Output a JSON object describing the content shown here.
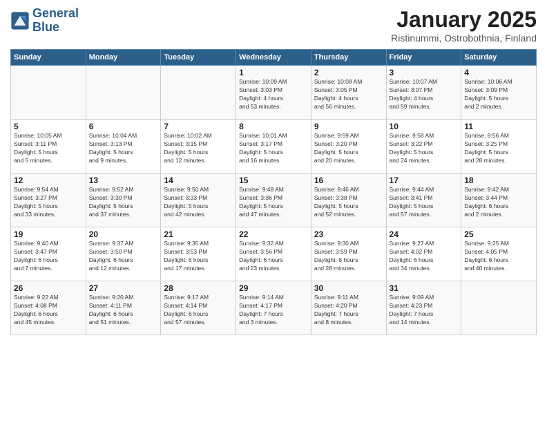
{
  "header": {
    "logo_line1": "General",
    "logo_line2": "Blue",
    "month_year": "January 2025",
    "location": "Ristinummi, Ostrobothnia, Finland"
  },
  "weekdays": [
    "Sunday",
    "Monday",
    "Tuesday",
    "Wednesday",
    "Thursday",
    "Friday",
    "Saturday"
  ],
  "weeks": [
    [
      {
        "day": "",
        "info": ""
      },
      {
        "day": "",
        "info": ""
      },
      {
        "day": "",
        "info": ""
      },
      {
        "day": "1",
        "info": "Sunrise: 10:09 AM\nSunset: 3:03 PM\nDaylight: 4 hours\nand 53 minutes."
      },
      {
        "day": "2",
        "info": "Sunrise: 10:08 AM\nSunset: 3:05 PM\nDaylight: 4 hours\nand 56 minutes."
      },
      {
        "day": "3",
        "info": "Sunrise: 10:07 AM\nSunset: 3:07 PM\nDaylight: 4 hours\nand 59 minutes."
      },
      {
        "day": "4",
        "info": "Sunrise: 10:06 AM\nSunset: 3:09 PM\nDaylight: 5 hours\nand 2 minutes."
      }
    ],
    [
      {
        "day": "5",
        "info": "Sunrise: 10:05 AM\nSunset: 3:11 PM\nDaylight: 5 hours\nand 5 minutes."
      },
      {
        "day": "6",
        "info": "Sunrise: 10:04 AM\nSunset: 3:13 PM\nDaylight: 5 hours\nand 9 minutes."
      },
      {
        "day": "7",
        "info": "Sunrise: 10:02 AM\nSunset: 3:15 PM\nDaylight: 5 hours\nand 12 minutes."
      },
      {
        "day": "8",
        "info": "Sunrise: 10:01 AM\nSunset: 3:17 PM\nDaylight: 5 hours\nand 16 minutes."
      },
      {
        "day": "9",
        "info": "Sunrise: 9:59 AM\nSunset: 3:20 PM\nDaylight: 5 hours\nand 20 minutes."
      },
      {
        "day": "10",
        "info": "Sunrise: 9:58 AM\nSunset: 3:22 PM\nDaylight: 5 hours\nand 24 minutes."
      },
      {
        "day": "11",
        "info": "Sunrise: 9:56 AM\nSunset: 3:25 PM\nDaylight: 5 hours\nand 28 minutes."
      }
    ],
    [
      {
        "day": "12",
        "info": "Sunrise: 9:54 AM\nSunset: 3:27 PM\nDaylight: 5 hours\nand 33 minutes."
      },
      {
        "day": "13",
        "info": "Sunrise: 9:52 AM\nSunset: 3:30 PM\nDaylight: 5 hours\nand 37 minutes."
      },
      {
        "day": "14",
        "info": "Sunrise: 9:50 AM\nSunset: 3:33 PM\nDaylight: 5 hours\nand 42 minutes."
      },
      {
        "day": "15",
        "info": "Sunrise: 9:48 AM\nSunset: 3:36 PM\nDaylight: 5 hours\nand 47 minutes."
      },
      {
        "day": "16",
        "info": "Sunrise: 9:46 AM\nSunset: 3:38 PM\nDaylight: 5 hours\nand 52 minutes."
      },
      {
        "day": "17",
        "info": "Sunrise: 9:44 AM\nSunset: 3:41 PM\nDaylight: 5 hours\nand 57 minutes."
      },
      {
        "day": "18",
        "info": "Sunrise: 9:42 AM\nSunset: 3:44 PM\nDaylight: 6 hours\nand 2 minutes."
      }
    ],
    [
      {
        "day": "19",
        "info": "Sunrise: 9:40 AM\nSunset: 3:47 PM\nDaylight: 6 hours\nand 7 minutes."
      },
      {
        "day": "20",
        "info": "Sunrise: 9:37 AM\nSunset: 3:50 PM\nDaylight: 6 hours\nand 12 minutes."
      },
      {
        "day": "21",
        "info": "Sunrise: 9:35 AM\nSunset: 3:53 PM\nDaylight: 6 hours\nand 17 minutes."
      },
      {
        "day": "22",
        "info": "Sunrise: 9:32 AM\nSunset: 3:56 PM\nDaylight: 6 hours\nand 23 minutes."
      },
      {
        "day": "23",
        "info": "Sunrise: 9:30 AM\nSunset: 3:59 PM\nDaylight: 6 hours\nand 28 minutes."
      },
      {
        "day": "24",
        "info": "Sunrise: 9:27 AM\nSunset: 4:02 PM\nDaylight: 6 hours\nand 34 minutes."
      },
      {
        "day": "25",
        "info": "Sunrise: 9:25 AM\nSunset: 4:05 PM\nDaylight: 6 hours\nand 40 minutes."
      }
    ],
    [
      {
        "day": "26",
        "info": "Sunrise: 9:22 AM\nSunset: 4:08 PM\nDaylight: 6 hours\nand 45 minutes."
      },
      {
        "day": "27",
        "info": "Sunrise: 9:20 AM\nSunset: 4:11 PM\nDaylight: 6 hours\nand 51 minutes."
      },
      {
        "day": "28",
        "info": "Sunrise: 9:17 AM\nSunset: 4:14 PM\nDaylight: 6 hours\nand 57 minutes."
      },
      {
        "day": "29",
        "info": "Sunrise: 9:14 AM\nSunset: 4:17 PM\nDaylight: 7 hours\nand 3 minutes."
      },
      {
        "day": "30",
        "info": "Sunrise: 9:11 AM\nSunset: 4:20 PM\nDaylight: 7 hours\nand 8 minutes."
      },
      {
        "day": "31",
        "info": "Sunrise: 9:09 AM\nSunset: 4:23 PM\nDaylight: 7 hours\nand 14 minutes."
      },
      {
        "day": "",
        "info": ""
      }
    ]
  ]
}
